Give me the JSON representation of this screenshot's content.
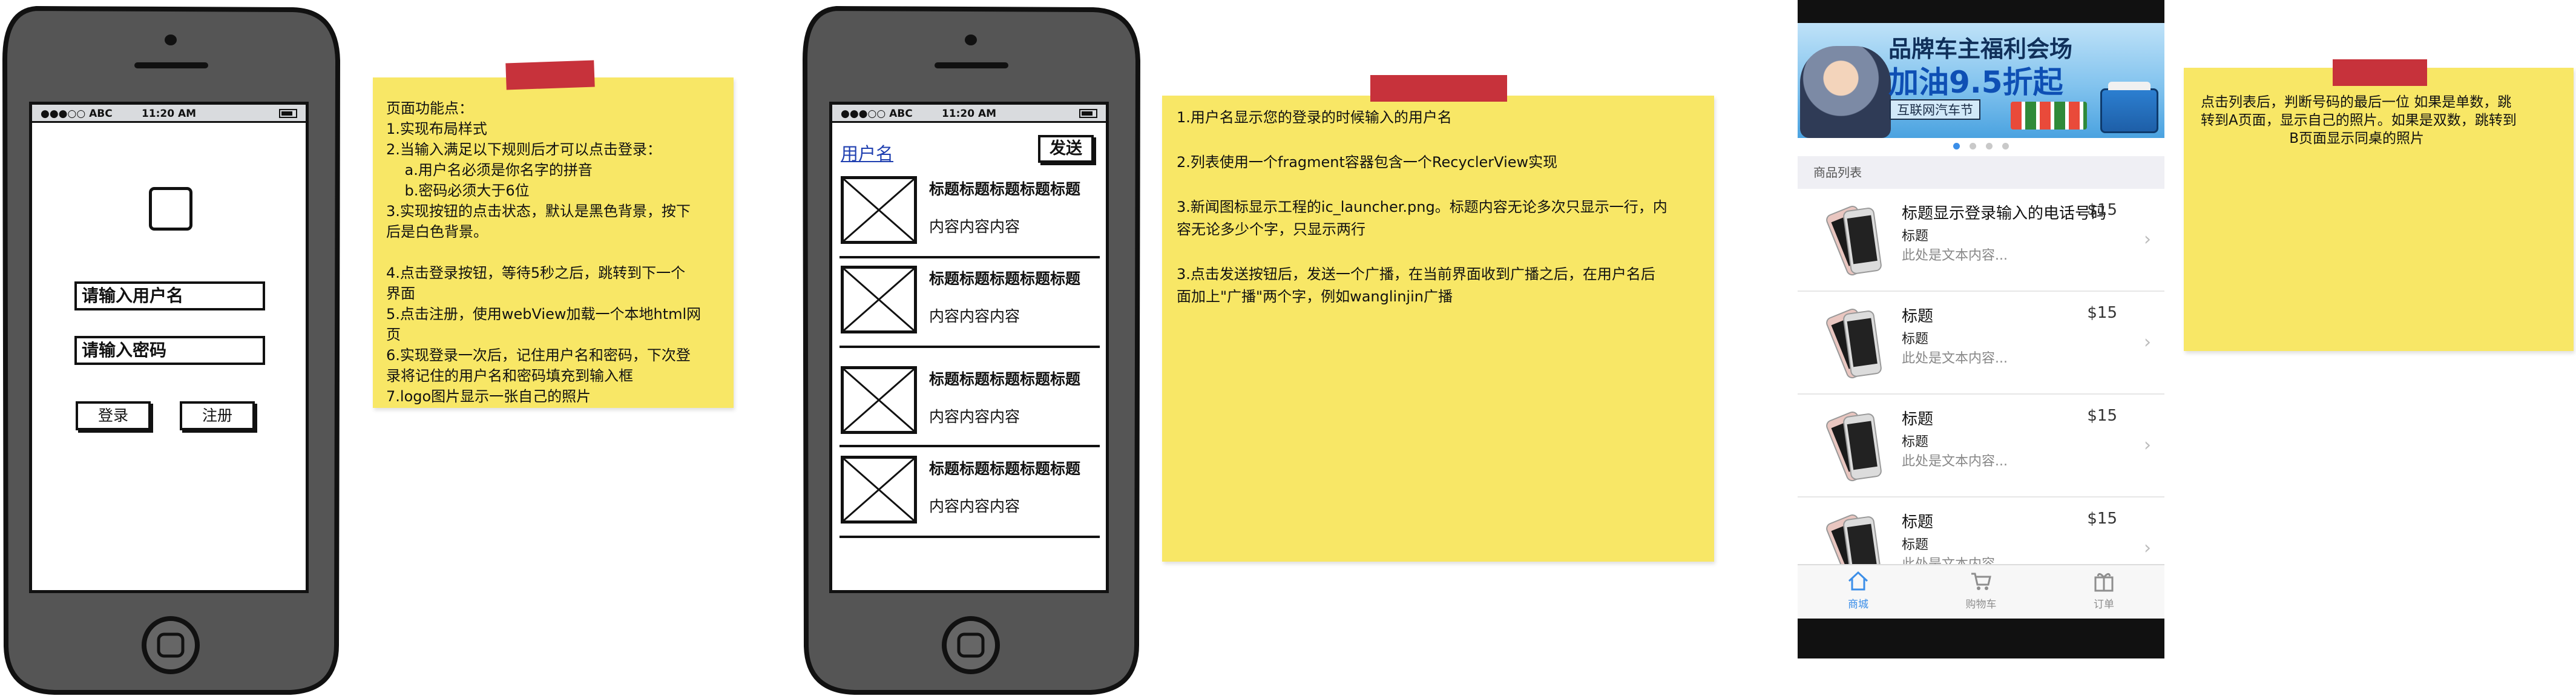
{
  "phone1": {
    "status": {
      "carrier": "●●●○○ ABC",
      "time": "11:20 AM"
    },
    "username_placeholder": "请输入用户名",
    "password_placeholder": "请输入密码",
    "login_label": "登录",
    "register_label": "注册"
  },
  "note1": {
    "lines": [
      "页面功能点：",
      "1.实现布局样式",
      "2.当输入满足以下规则后才可以点击登录：",
      "    a.用户名必须是你名字的拼音",
      "    b.密码必须大于6位",
      "3.实现按钮的点击状态，默认是黑色背景，按下",
      "后是白色背景。",
      "",
      "4.点击登录按钮，等待5秒之后，跳转到下一个",
      "界面",
      "5.点击注册，使用webView加载一个本地html网",
      "页",
      "6.实现登录一次后，记住用户名和密码，下次登",
      "录将记住的用户名和密码填充到输入框",
      "7.logo图片显示一张自己的照片"
    ]
  },
  "phone2": {
    "status": {
      "carrier": "●●●○○ ABC",
      "time": "11:20 AM"
    },
    "username_link": "用户名",
    "send_label": "发送",
    "items": [
      {
        "title": "标题标题标题标题标题",
        "body": "内容内容内容"
      },
      {
        "title": "标题标题标题标题标题",
        "body": "内容内容内容"
      },
      {
        "title": "标题标题标题标题标题",
        "body": "内容内容内容"
      },
      {
        "title": "标题标题标题标题标题",
        "body": "内容内容内容"
      }
    ]
  },
  "note2": {
    "lines": [
      "1.用户名显示您的登录的时候输入的用户名",
      "",
      "2.列表使用一个fragment容器包含一个RecyclerView实现",
      "",
      "3.新闻图标显示工程的ic_launcher.png。标题内容无论多次只显示一行，内",
      "容无论多少个字，只显示两行",
      "",
      "3.点击发送按钮后，发送一个广播，在当前界面收到广播之后，在用户名后",
      "面加上\"广播\"两个字，例如wanglinjin广播"
    ]
  },
  "app": {
    "banner": {
      "line1": "品牌车主福利会场",
      "line2": "加油9.5折起",
      "line3": "互联网汽车节"
    },
    "section_title": "商品列表",
    "products": [
      {
        "title": "标题显示登录输入的电话号码",
        "price": "$15",
        "subtitle": "标题",
        "desc": "此处是文本内容..."
      },
      {
        "title": "标题",
        "price": "$15",
        "subtitle": "标题",
        "desc": "此处是文本内容..."
      },
      {
        "title": "标题",
        "price": "$15",
        "subtitle": "标题",
        "desc": "此处是文本内容..."
      },
      {
        "title": "标题",
        "price": "$15",
        "subtitle": "标题",
        "desc": "此处是文本内容..."
      }
    ],
    "tabs": [
      {
        "label": "商城",
        "icon": "home-icon",
        "active": true
      },
      {
        "label": "购物车",
        "icon": "cart-icon",
        "active": false
      },
      {
        "label": "订单",
        "icon": "gift-icon",
        "active": false
      }
    ],
    "accent_color": "#3b8ee8"
  },
  "note3": {
    "lines": [
      "点击列表后，判断号码的最后一位 如果是单数，跳",
      "转到A页面，显示自己的照片。如果是双数，跳转到",
      "                    B页面显示同桌的照片"
    ]
  }
}
